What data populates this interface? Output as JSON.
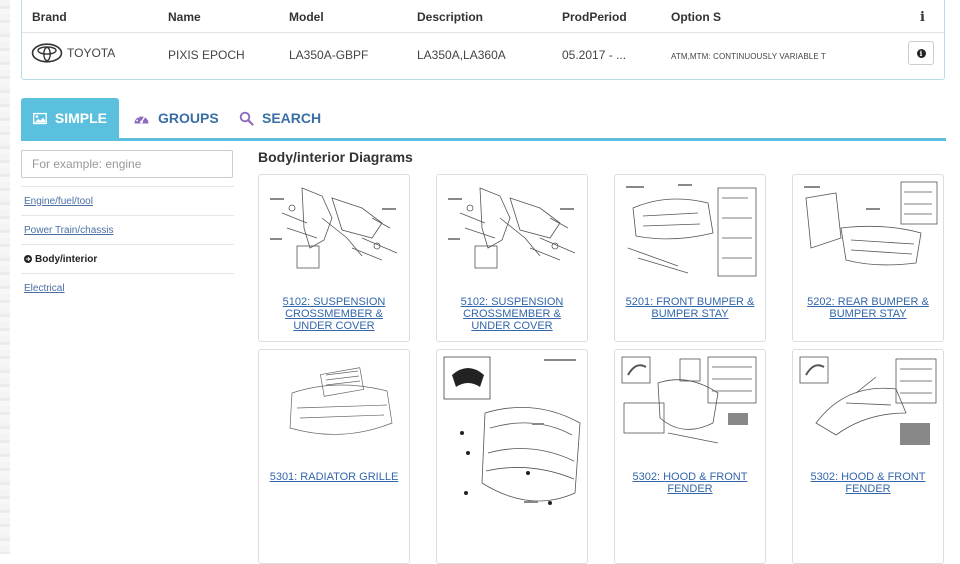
{
  "vehicle": {
    "headers": [
      "Brand",
      "Name",
      "Model",
      "Description",
      "ProdPeriod",
      "Option S"
    ],
    "info_header": "i",
    "row": {
      "brand": "TOYOTA",
      "name": "PIXIS EPOCH",
      "model": "LA350A-GBPF",
      "description": "LA350A,LA360A",
      "prod_period": "05.2017 - ...",
      "option": "ATM,MTM: CONTINUOUSLY VARIABLE T"
    },
    "logo_icon": "toyota-logo-icon",
    "info_icon": "info-circle-icon"
  },
  "tabs": [
    {
      "label": "SIMPLE",
      "icon": "image-icon",
      "active": true
    },
    {
      "label": "GROUPS",
      "icon": "dashboard-icon",
      "active": false
    },
    {
      "label": "SEARCH",
      "icon": "search-icon",
      "active": false
    }
  ],
  "sidebar": {
    "search_placeholder": "For example: engine",
    "items": [
      {
        "label": "Engine/fuel/tool",
        "active": false
      },
      {
        "label": "Power Train/chassis",
        "active": false
      },
      {
        "label": "Body/interior",
        "active": true
      },
      {
        "label": "Electrical",
        "active": false
      }
    ]
  },
  "section": {
    "title": "Body/interior Diagrams"
  },
  "diagrams": [
    {
      "caption": "5102: SUSPENSION CROSSMEMBER & UNDER COVER"
    },
    {
      "caption": "5102: SUSPENSION CROSSMEMBER & UNDER COVER"
    },
    {
      "caption": "5201: FRONT BUMPER & BUMPER STAY"
    },
    {
      "caption": "5202: REAR BUMPER & BUMPER STAY"
    },
    {
      "caption": "5301: RADIATOR GRILLE"
    },
    {
      "caption": ""
    },
    {
      "caption": "5302: HOOD & FRONT FENDER"
    },
    {
      "caption": "5302: HOOD & FRONT FENDER"
    }
  ],
  "colors": {
    "accent": "#5bc0de",
    "link": "#3366aa",
    "tab_text": "#3a6fa6"
  }
}
